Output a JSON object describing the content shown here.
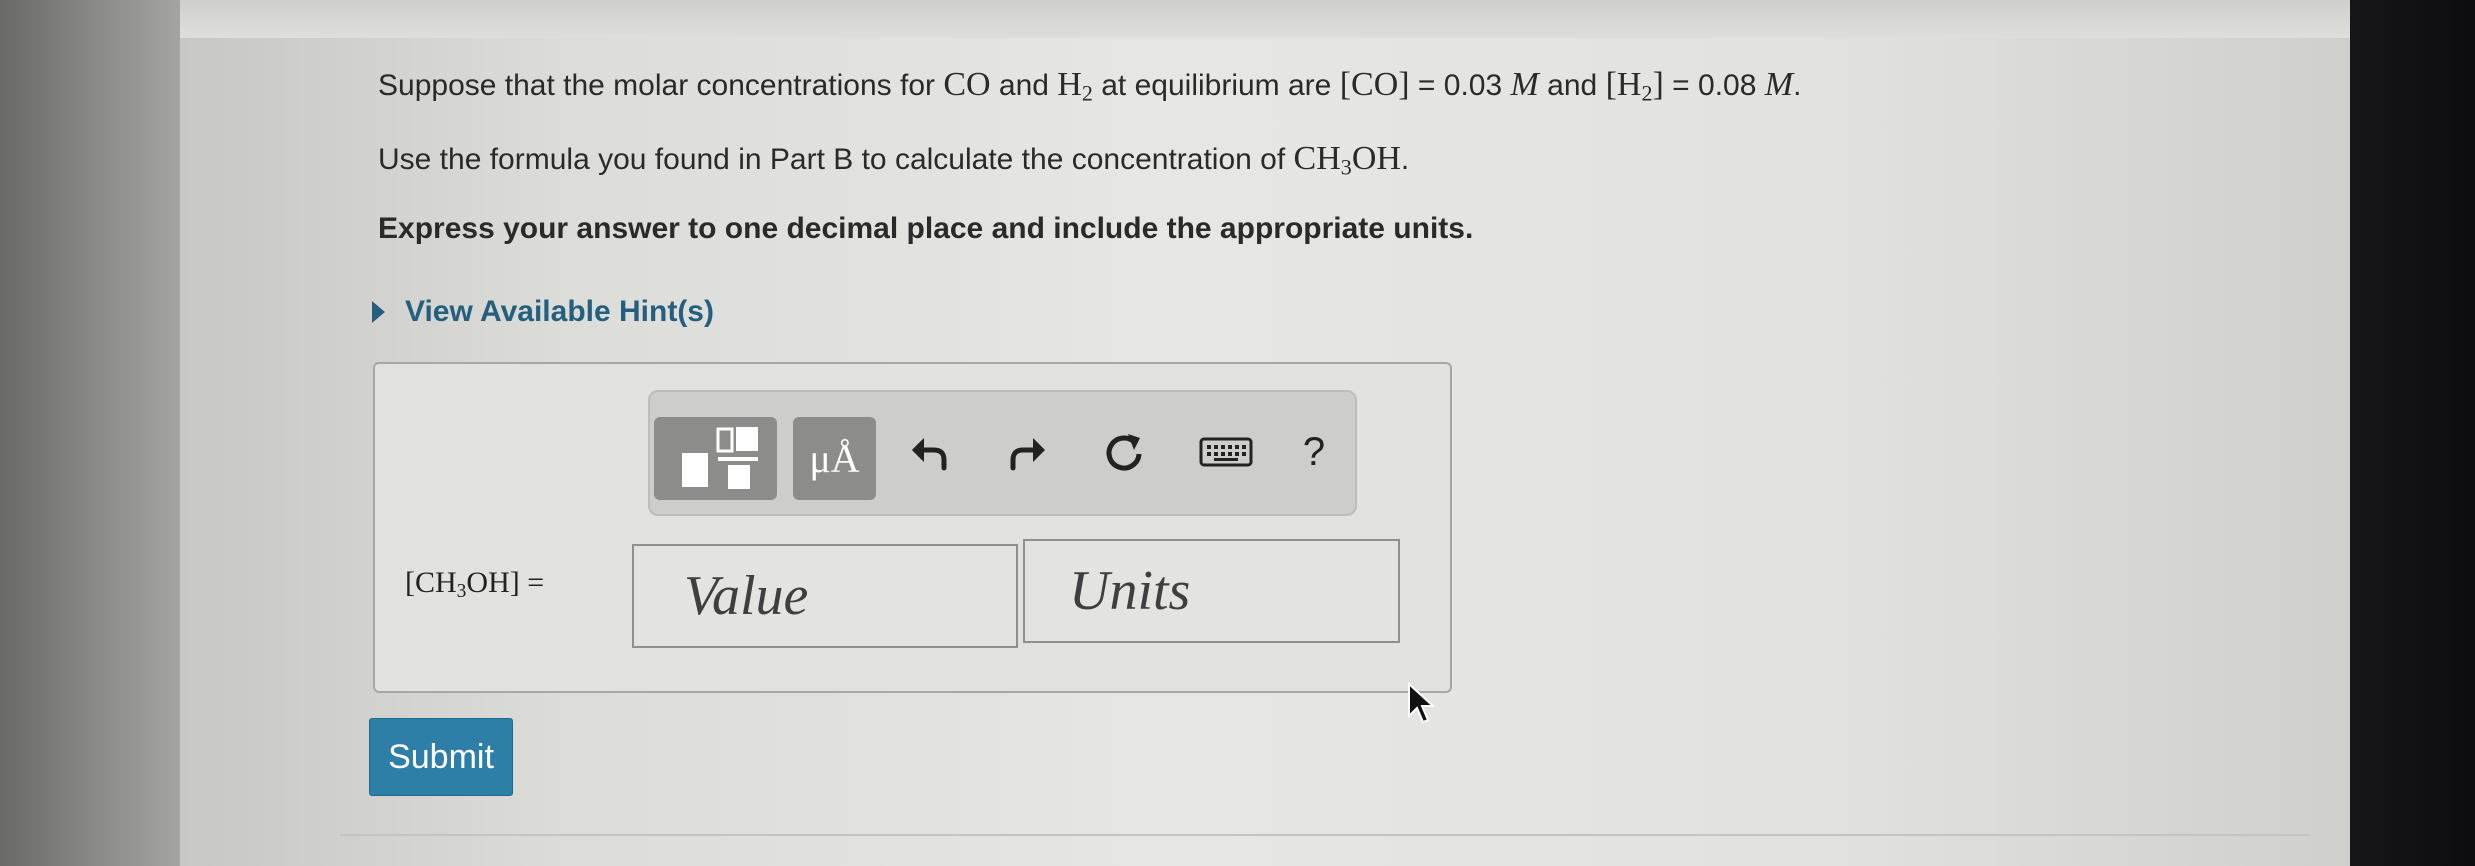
{
  "question": {
    "line1": {
      "p1": "Suppose that the molar concentrations for ",
      "co": "CO",
      "p2": " and ",
      "h": "H",
      "h_sub": "2",
      "p3": " at equilibrium are ",
      "co_bracket": "[CO]",
      "p4": " = 0.03 ",
      "unit_m": "M",
      "p5": " and ",
      "h2_open": "[H",
      "h2_sub": "2",
      "h2_close": "]",
      "p6": " = 0.08 ",
      "unit_m2": "M",
      "p7": "."
    },
    "line2": {
      "text": "Use the formula you found in Part B to calculate the concentration of ",
      "ch": "CH",
      "ch_sub": "3",
      "oh": "OH",
      "end": "."
    },
    "line3": "Express your answer to one decimal place and include the appropriate units."
  },
  "hint": {
    "label": "View Available Hint(s)"
  },
  "toolbar": {
    "units_label": "μÅ",
    "help_label": "?",
    "icons": [
      "templates-icon",
      "undo-icon",
      "redo-icon",
      "reset-icon",
      "keyboard-icon",
      "help-icon"
    ]
  },
  "answer": {
    "label_open": "[CH",
    "label_sub": "3",
    "label_close": "OH] =",
    "value_placeholder": "Value",
    "units_placeholder": "Units"
  },
  "submit": {
    "label": "Submit"
  },
  "colors": {
    "accent": "#2e7fa7",
    "hint": "#245f7f",
    "toolbar_button": "#8c8c8a"
  }
}
